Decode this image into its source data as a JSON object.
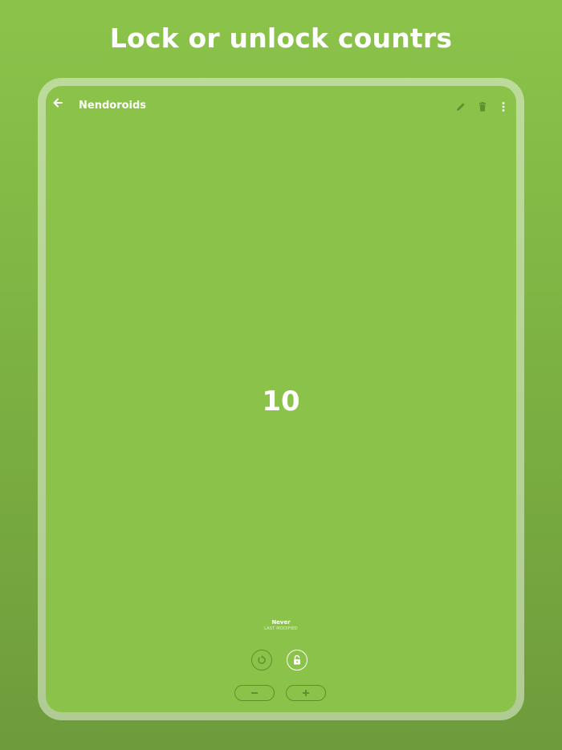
{
  "headline": "Lock or unlock countrs",
  "toolbar": {
    "title": "Nendoroids",
    "back_icon": "arrow-left-icon",
    "edit_icon": "pencil-icon",
    "delete_icon": "trash-icon",
    "more_icon": "more-vert-icon"
  },
  "counter": {
    "value": "10"
  },
  "last_modified": {
    "value": "Never",
    "label": "LAST MODIFIED"
  },
  "controls": {
    "reset_icon": "reset-icon",
    "lock_icon": "unlocked-padlock-icon",
    "decrement_icon": "minus-icon",
    "increment_icon": "plus-icon"
  },
  "colors": {
    "background": "#8bc34a",
    "accent_dark": "#5f8f2f",
    "text": "#ffffff"
  }
}
